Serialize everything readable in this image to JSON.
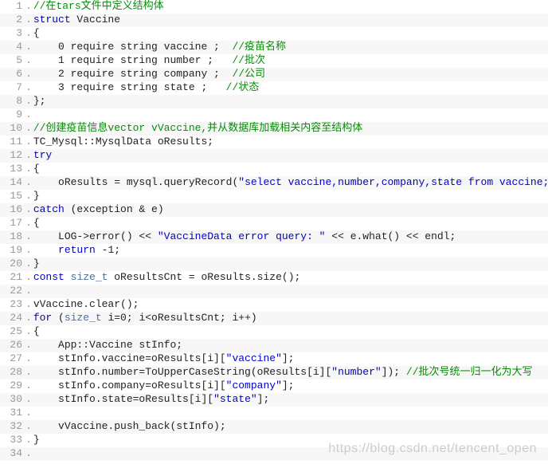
{
  "watermark": "https://blog.csdn.net/tencent_open",
  "lines": [
    {
      "n": 1,
      "tokens": [
        {
          "cls": "t-comment",
          "text": "//在tars文件中定义结构体"
        }
      ]
    },
    {
      "n": 2,
      "tokens": [
        {
          "cls": "t-keyword",
          "text": "struct"
        },
        {
          "cls": "t-plain",
          "text": " Vaccine"
        }
      ]
    },
    {
      "n": 3,
      "tokens": [
        {
          "cls": "t-brace",
          "text": "{"
        }
      ]
    },
    {
      "n": 4,
      "tokens": [
        {
          "cls": "t-plain",
          "text": "    0 require string vaccine ;  "
        },
        {
          "cls": "t-comment",
          "text": "//疫苗名称"
        }
      ]
    },
    {
      "n": 5,
      "tokens": [
        {
          "cls": "t-plain",
          "text": "    1 require string number ;   "
        },
        {
          "cls": "t-comment",
          "text": "//批次"
        }
      ]
    },
    {
      "n": 6,
      "tokens": [
        {
          "cls": "t-plain",
          "text": "    2 require string company ;  "
        },
        {
          "cls": "t-comment",
          "text": "//公司"
        }
      ]
    },
    {
      "n": 7,
      "tokens": [
        {
          "cls": "t-plain",
          "text": "    3 require string state ;   "
        },
        {
          "cls": "t-comment",
          "text": "//状态"
        }
      ]
    },
    {
      "n": 8,
      "tokens": [
        {
          "cls": "t-brace",
          "text": "};"
        }
      ]
    },
    {
      "n": 9,
      "tokens": [
        {
          "cls": "t-plain",
          "text": ""
        }
      ]
    },
    {
      "n": 10,
      "tokens": [
        {
          "cls": "t-comment",
          "text": "//创建疫苗信息vector vVaccine,并从数据库加载相关内容至结构体"
        }
      ]
    },
    {
      "n": 11,
      "tokens": [
        {
          "cls": "t-plain",
          "text": "TC_Mysql::MysqlData oResults;"
        }
      ]
    },
    {
      "n": 12,
      "tokens": [
        {
          "cls": "t-keyword",
          "text": "try"
        }
      ]
    },
    {
      "n": 13,
      "tokens": [
        {
          "cls": "t-brace",
          "text": "{"
        }
      ]
    },
    {
      "n": 14,
      "tokens": [
        {
          "cls": "t-plain",
          "text": "    oResults = mysql.queryRecord("
        },
        {
          "cls": "t-string",
          "text": "\"select vaccine,number,company,state from vaccine;\""
        },
        {
          "cls": "t-plain",
          "text": ");"
        }
      ]
    },
    {
      "n": 15,
      "tokens": [
        {
          "cls": "t-brace",
          "text": "}"
        }
      ]
    },
    {
      "n": 16,
      "tokens": [
        {
          "cls": "t-keyword",
          "text": "catch"
        },
        {
          "cls": "t-plain",
          "text": " (exception & e)"
        }
      ]
    },
    {
      "n": 17,
      "tokens": [
        {
          "cls": "t-brace",
          "text": "{"
        }
      ]
    },
    {
      "n": 18,
      "tokens": [
        {
          "cls": "t-plain",
          "text": "    LOG->error() << "
        },
        {
          "cls": "t-string",
          "text": "\"VaccineData error query: \""
        },
        {
          "cls": "t-plain",
          "text": " << e.what() << endl;"
        }
      ]
    },
    {
      "n": 19,
      "tokens": [
        {
          "cls": "t-plain",
          "text": "    "
        },
        {
          "cls": "t-keyword",
          "text": "return"
        },
        {
          "cls": "t-plain",
          "text": " -1;"
        }
      ]
    },
    {
      "n": 20,
      "tokens": [
        {
          "cls": "t-brace",
          "text": "}"
        }
      ]
    },
    {
      "n": 21,
      "tokens": [
        {
          "cls": "t-keyword",
          "text": "const"
        },
        {
          "cls": "t-plain",
          "text": " "
        },
        {
          "cls": "t-type",
          "text": "size_t"
        },
        {
          "cls": "t-plain",
          "text": " oResultsCnt = oResults.size();"
        }
      ]
    },
    {
      "n": 22,
      "tokens": [
        {
          "cls": "t-plain",
          "text": ""
        }
      ]
    },
    {
      "n": 23,
      "tokens": [
        {
          "cls": "t-plain",
          "text": "vVaccine.clear();"
        }
      ]
    },
    {
      "n": 24,
      "tokens": [
        {
          "cls": "t-keyword",
          "text": "for"
        },
        {
          "cls": "t-plain",
          "text": " ("
        },
        {
          "cls": "t-type",
          "text": "size_t"
        },
        {
          "cls": "t-plain",
          "text": " i=0; i<oResultsCnt; i++)"
        }
      ]
    },
    {
      "n": 25,
      "tokens": [
        {
          "cls": "t-brace",
          "text": "{"
        }
      ]
    },
    {
      "n": 26,
      "tokens": [
        {
          "cls": "t-plain",
          "text": "    App::Vaccine stInfo;"
        }
      ]
    },
    {
      "n": 27,
      "tokens": [
        {
          "cls": "t-plain",
          "text": "    stInfo.vaccine=oResults[i]["
        },
        {
          "cls": "t-string",
          "text": "\"vaccine\""
        },
        {
          "cls": "t-plain",
          "text": "];"
        }
      ]
    },
    {
      "n": 28,
      "tokens": [
        {
          "cls": "t-plain",
          "text": "    stInfo.number=ToUpperCaseString(oResults[i]["
        },
        {
          "cls": "t-string",
          "text": "\"number\""
        },
        {
          "cls": "t-plain",
          "text": "]); "
        },
        {
          "cls": "t-comment",
          "text": "//批次号统一归一化为大写"
        }
      ]
    },
    {
      "n": 29,
      "tokens": [
        {
          "cls": "t-plain",
          "text": "    stInfo.company=oResults[i]["
        },
        {
          "cls": "t-string",
          "text": "\"company\""
        },
        {
          "cls": "t-plain",
          "text": "];"
        }
      ]
    },
    {
      "n": 30,
      "tokens": [
        {
          "cls": "t-plain",
          "text": "    stInfo.state=oResults[i]["
        },
        {
          "cls": "t-string",
          "text": "\"state\""
        },
        {
          "cls": "t-plain",
          "text": "];"
        }
      ]
    },
    {
      "n": 31,
      "tokens": [
        {
          "cls": "t-plain",
          "text": ""
        }
      ]
    },
    {
      "n": 32,
      "tokens": [
        {
          "cls": "t-plain",
          "text": "    vVaccine.push_back(stInfo);"
        }
      ]
    },
    {
      "n": 33,
      "tokens": [
        {
          "cls": "t-brace",
          "text": "}"
        }
      ]
    },
    {
      "n": 34,
      "tokens": [
        {
          "cls": "t-plain",
          "text": ""
        }
      ]
    }
  ]
}
